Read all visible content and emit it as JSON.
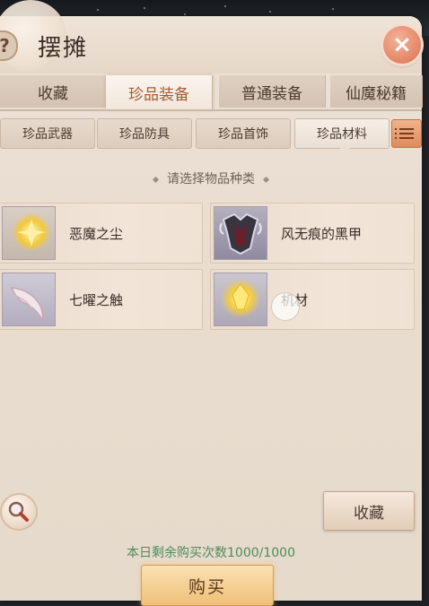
{
  "title": "摆摊",
  "help_label": "?",
  "close_label": "×",
  "tabs": [
    {
      "label": "收藏",
      "active": false
    },
    {
      "label": "珍品装备",
      "active": true
    },
    {
      "label": "普通装备",
      "active": false
    },
    {
      "label": "仙魔秘籍",
      "active": false
    }
  ],
  "subtabs": [
    {
      "label": "珍品武器",
      "active": false
    },
    {
      "label": "珍品防具",
      "active": false
    },
    {
      "label": "珍品首饰",
      "active": false
    },
    {
      "label": "珍品材料",
      "active": true
    }
  ],
  "section_title": "请选择物品种类",
  "categories": [
    {
      "label": "恶魔之尘",
      "icon": "golden-dust-icon"
    },
    {
      "label": "风无痕的黑甲",
      "icon": "black-armor-icon"
    },
    {
      "label": "七曜之触",
      "icon": "silver-horn-icon"
    },
    {
      "label": "机材",
      "icon": "golden-crystal-icon"
    }
  ],
  "favorite_button": "收藏",
  "remaining_text": "本日剩余购买次数1000/1000",
  "buy_button": "购买",
  "colors": {
    "accent": "#de8b5c",
    "active_tab_text": "#a45a36",
    "remaining_text": "#4f8a5a",
    "close_button": "#e28564"
  }
}
